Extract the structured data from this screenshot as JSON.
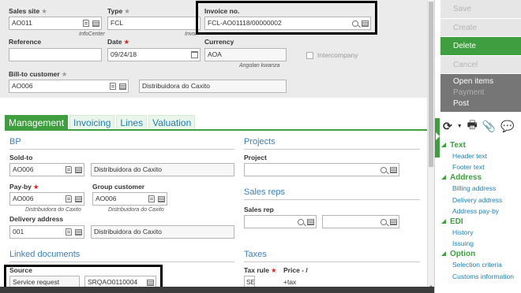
{
  "header": {
    "sales_site": {
      "label": "Sales site",
      "value": "AO011",
      "sub": "InfoCenter"
    },
    "type": {
      "label": "Type",
      "value": "FCL",
      "sub": "Invoi"
    },
    "invoice_no": {
      "label": "Invoice no.",
      "value": "FCL-AO01118/00000002"
    },
    "reference": {
      "label": "Reference",
      "value": ""
    },
    "date": {
      "label": "Date",
      "value": "09/24/18"
    },
    "currency": {
      "label": "Currency",
      "value": "AOA",
      "sub": "Angolan kwanza"
    },
    "intercompany": {
      "label": "Intercompany"
    },
    "bill_to": {
      "label": "Bill-to customer",
      "value": "AO006",
      "name": "Distribuidora do Caxito"
    }
  },
  "tabs": [
    {
      "label": "Management"
    },
    {
      "label": "Invoicing"
    },
    {
      "label": "Lines"
    },
    {
      "label": "Valuation"
    }
  ],
  "bp": {
    "title": "BP",
    "sold_to": {
      "label": "Sold-to",
      "value": "AO006",
      "name": "Distribuidora do Caxito"
    },
    "pay_by": {
      "label": "Pay-by",
      "value": "AO006",
      "sub": "Distribuidora do Caxito"
    },
    "group_customer": {
      "label": "Group customer",
      "value": "AO006",
      "sub": "Distribuidora do Caxito"
    },
    "delivery_address": {
      "label": "Delivery address",
      "value": "001",
      "name": "Distribuidora do Caxito"
    }
  },
  "projects": {
    "title": "Projects",
    "project": {
      "label": "Project",
      "value": ""
    }
  },
  "sales_reps": {
    "title": "Sales reps",
    "sales_rep": {
      "label": "Sales rep",
      "value": ""
    }
  },
  "linked": {
    "title": "Linked documents",
    "source": {
      "label": "Source",
      "value": "Service request",
      "ref": "SRQAO0110004"
    }
  },
  "taxes": {
    "title": "Taxes",
    "tax_rule": {
      "label": "Tax rule",
      "value": "SE"
    },
    "price": {
      "label": "Price - /",
      "value": "+tax"
    }
  },
  "actions": {
    "save": "Save",
    "create": "Create",
    "delete": "Delete",
    "cancel": "Cancel",
    "open_items": "Open items",
    "payment": "Payment",
    "post": "Post"
  },
  "sidebar": {
    "groups": [
      {
        "title": "Text",
        "items": [
          "Header text",
          "Footer text"
        ]
      },
      {
        "title": "Address",
        "items": [
          "Billing address",
          "Delivery address",
          "Address pay-by"
        ]
      },
      {
        "title": "EDI",
        "items": [
          "History",
          "Issuing"
        ]
      },
      {
        "title": "Option",
        "items": [
          "Selection criteria",
          "Customs information"
        ]
      }
    ]
  },
  "colors": {
    "accent": "#3f9e3f",
    "link": "#1e7fb8",
    "section": "#3b7fbf",
    "required": "#e2201b"
  }
}
